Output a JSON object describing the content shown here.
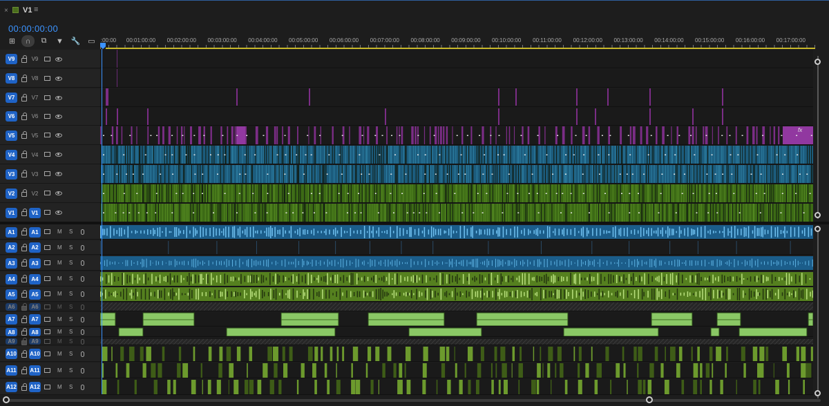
{
  "panel": {
    "close_icon": "×",
    "sequence_name": "V1",
    "menu_icon": "≡",
    "timecode": "00:00:00:00"
  },
  "toolbar": [
    {
      "name": "nest-toggle-icon",
      "glyph": "⊞"
    },
    {
      "name": "snap-icon",
      "glyph": "∩",
      "active": true
    },
    {
      "name": "linked-selection-icon",
      "glyph": "⧉"
    },
    {
      "name": "add-marker-icon",
      "glyph": "▼"
    },
    {
      "name": "wrench-settings-icon",
      "glyph": "🔧"
    },
    {
      "name": "captions-icon",
      "glyph": "▭"
    }
  ],
  "ruler": {
    "labels": [
      ":00:00",
      "00:01:00:00",
      "00:02:00:00",
      "00:03:00:00",
      "00:04:00:00",
      "00:05:00:00",
      "00:06:00:00",
      "00:07:00:00",
      "00:08:00:00",
      "00:09:00:00",
      "00:10:00:00",
      "00:11:00:00",
      "00:12:00:00",
      "00:13:00:00",
      "00:14:00:00",
      "00:15:00:00",
      "00:16:00:00",
      "00:17:00:00"
    ]
  },
  "video_tracks": [
    {
      "src": "V9",
      "name": "V9",
      "target": false
    },
    {
      "src": "V8",
      "name": "V8",
      "target": false
    },
    {
      "src": "V7",
      "name": "V7",
      "target": false
    },
    {
      "src": "V6",
      "name": "V6",
      "target": false
    },
    {
      "src": "V5",
      "name": "V5",
      "target": false
    },
    {
      "src": "V4",
      "name": "V4",
      "target": false
    },
    {
      "src": "V3",
      "name": "V3",
      "target": false
    },
    {
      "src": "V2",
      "name": "V2",
      "target": false
    },
    {
      "src": "V1",
      "name": "V1",
      "target": true
    }
  ],
  "audio_tracks": [
    {
      "src": "A1",
      "name": "A1",
      "m": "M",
      "s": "S"
    },
    {
      "src": "A2",
      "name": "A2",
      "m": "M",
      "s": "S"
    },
    {
      "src": "A3",
      "name": "A3",
      "m": "M",
      "s": "S"
    },
    {
      "src": "A4",
      "name": "A4",
      "m": "M",
      "s": "S"
    },
    {
      "src": "A5",
      "name": "A5",
      "m": "M",
      "s": "S"
    },
    {
      "src": "A6",
      "name": "A6",
      "m": "M",
      "s": "S",
      "locked": true
    },
    {
      "src": "A7",
      "name": "A7",
      "m": "M",
      "s": "S"
    },
    {
      "src": "A8",
      "name": "A8",
      "m": "M",
      "s": "S"
    },
    {
      "src": "A9",
      "name": "A9",
      "m": "M",
      "s": "S",
      "locked": true
    },
    {
      "src": "A10",
      "name": "A10",
      "m": "M",
      "s": "S"
    },
    {
      "src": "A11",
      "name": "A11",
      "m": "M",
      "s": "S"
    },
    {
      "src": "A12",
      "name": "A12",
      "m": "M",
      "s": "S"
    }
  ],
  "clip_effect_label": "fx",
  "colors": {
    "accent": "#3b93ff",
    "track_button": "#1f63c6",
    "adjustment_clip": "#7b2d86",
    "video_blue": "#1c5c7d",
    "video_green": "#3c6a15",
    "audio_blue": "#1b5d8a",
    "audio_green": "#55801f",
    "audio_clip_light": "#8ac865"
  }
}
